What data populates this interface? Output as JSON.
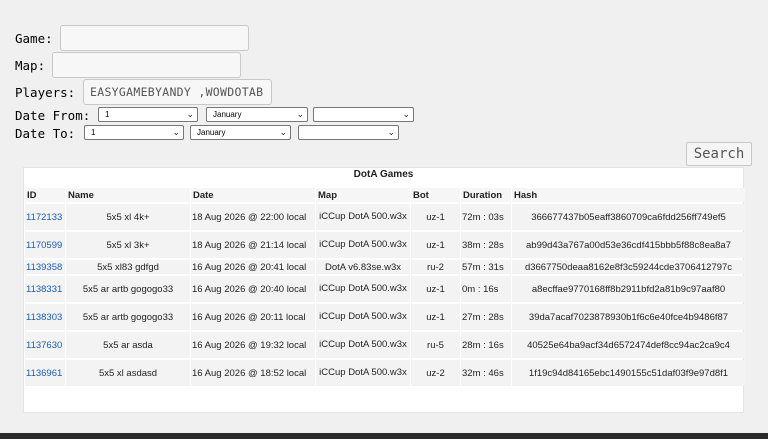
{
  "form": {
    "game_label": "Game:",
    "game_value": "",
    "map_label": "Map:",
    "map_value": "",
    "players_label": "Players:",
    "players_value": "EASYGAMEBYANDY ,WOWDOTAB",
    "date_from_label": "Date From:",
    "date_to_label": "Date To:",
    "date_from": {
      "day": "1",
      "month": "January",
      "year": ""
    },
    "date_to": {
      "day": "1",
      "month": "January",
      "year": ""
    },
    "search_label": "Search"
  },
  "table": {
    "caption": "DotA Games",
    "headers": [
      "ID",
      "Name",
      "Date",
      "Map",
      "Bot",
      "Duration",
      "Hash"
    ],
    "rows": [
      {
        "id": "1172133",
        "name": "5x5 xl 4k+",
        "date": "18 Aug 2026 @ 22:00 local",
        "map": "iCCup DotA 500.w3x",
        "bot": "uz-1",
        "duration": "72m : 03s",
        "hash": "366677437b05eaff3860709ca6fdd256ff749ef5"
      },
      {
        "id": "1170599",
        "name": "5x5 xl 3k+",
        "date": "18 Aug 2026 @ 21:14 local",
        "map": "iCCup DotA 500.w3x",
        "bot": "uz-1",
        "duration": "38m : 28s",
        "hash": "ab99d43a767a00d53e36cdf415bbb5f88c8ea8a7"
      },
      {
        "id": "1139358",
        "name": "5x5 xl83 gdfgd",
        "date": "16 Aug 2026 @ 20:41 local",
        "map": "DotA v6.83se.w3x",
        "bot": "ru-2",
        "duration": "57m : 31s",
        "hash": "d3667750deaa8162e8f3c59244cde3706412797c"
      },
      {
        "id": "1138331",
        "name": "5x5 ar artb gogogo33",
        "date": "16 Aug 2026 @ 20:40 local",
        "map": "iCCup DotA 500.w3x",
        "bot": "uz-1",
        "duration": "0m : 16s",
        "hash": "a8ecffae9770168ff8b2911bfd2a81b9c97aaf80"
      },
      {
        "id": "1138303",
        "name": "5x5 ar artb gogogo33",
        "date": "16 Aug 2026 @ 20:11 local",
        "map": "iCCup DotA 500.w3x",
        "bot": "uz-1",
        "duration": "27m : 28s",
        "hash": "39da7acaf7023878930b1f6c6e40fce4b9486f87"
      },
      {
        "id": "1137630",
        "name": "5x5 ar asda",
        "date": "16 Aug 2026 @ 19:32 local",
        "map": "iCCup DotA 500.w3x",
        "bot": "ru-5",
        "duration": "28m : 16s",
        "hash": "40525e64ba9acf34d6572474def8cc94ac2ca9c4"
      },
      {
        "id": "1136961",
        "name": "5x5 xl asdasd",
        "date": "16 Aug 2026 @ 18:52 local",
        "map": "iCCup DotA 500.w3x",
        "bot": "uz-2",
        "duration": "32m : 46s",
        "hash": "1f19c94d84165ebc1490155c51daf03f9e97d8f1"
      }
    ]
  }
}
